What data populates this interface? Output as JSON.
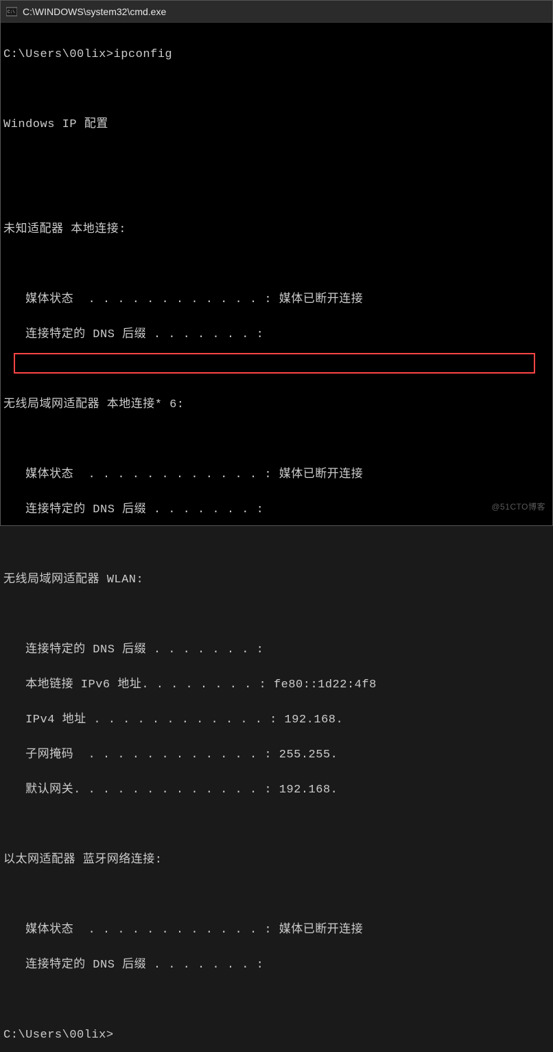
{
  "titleBar": {
    "title": "C:\\WINDOWS\\system32\\cmd.exe"
  },
  "terminal": {
    "prompt1": "C:\\Users\\00lix>ipconfig",
    "headerLine": "Windows IP 配置",
    "section1": {
      "title": "未知适配器 本地连接:",
      "line1": "   媒体状态  . . . . . . . . . . . . : 媒体已断开连接",
      "line2": "   连接特定的 DNS 后缀 . . . . . . . :"
    },
    "section2": {
      "title": "无线局域网适配器 本地连接* 6:",
      "line1": "   媒体状态  . . . . . . . . . . . . : 媒体已断开连接",
      "line2": "   连接特定的 DNS 后缀 . . . . . . . :"
    },
    "section3": {
      "title": "无线局域网适配器 WLAN:",
      "line1": "   连接特定的 DNS 后缀 . . . . . . . :",
      "line2": "   本地链接 IPv6 地址. . . . . . . . : fe80::1d22:4f8",
      "line3": "   IPv4 地址 . . . . . . . . . . . . : 192.168.",
      "line4": "   子网掩码  . . . . . . . . . . . . : 255.255.",
      "line5": "   默认网关. . . . . . . . . . . . . : 192.168."
    },
    "section4": {
      "title": "以太网适配器 蓝牙网络连接:",
      "line1": "   媒体状态  . . . . . . . . . . . . : 媒体已断开连接",
      "line2": "   连接特定的 DNS 后缀 . . . . . . . :"
    },
    "prompt2": "C:\\Users\\00lix>"
  },
  "watermark": "@51CTO博客"
}
